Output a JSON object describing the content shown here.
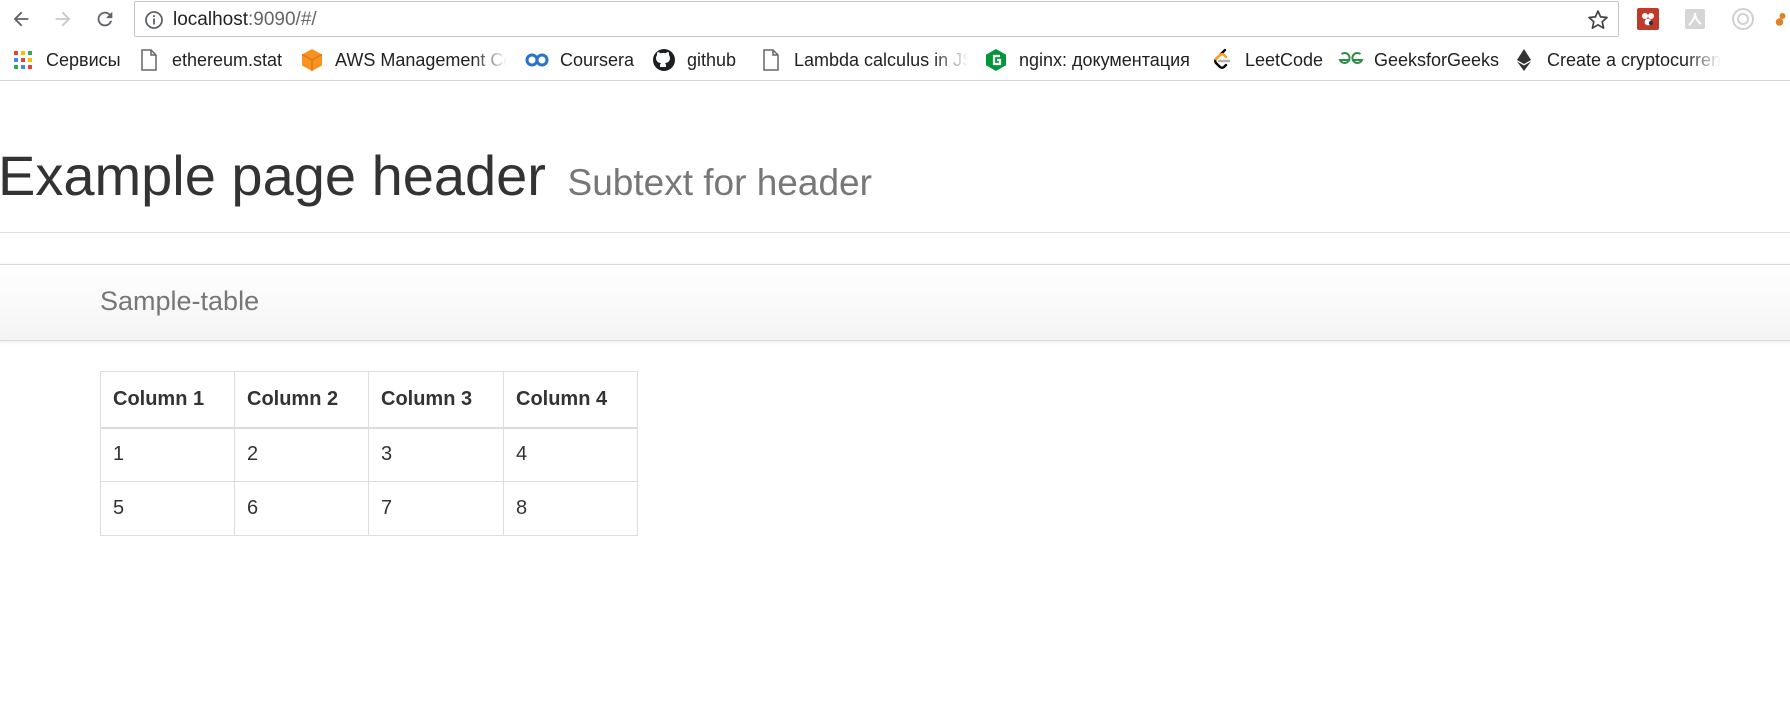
{
  "browser": {
    "url_host": "localhost",
    "url_rest": ":9090/#/"
  },
  "bookmarks": [
    {
      "label": "Сервисы",
      "icon": "apps-grid-icon"
    },
    {
      "label": "ethereum.stat",
      "icon": "page-icon"
    },
    {
      "label": "AWS Management Co",
      "icon": "aws-cube-icon"
    },
    {
      "label": "Coursera",
      "icon": "coursera-icon"
    },
    {
      "label": "github",
      "icon": "github-icon"
    },
    {
      "label": "Lambda calculus in JS",
      "icon": "page-icon"
    },
    {
      "label": "nginx: документация",
      "icon": "nginx-icon"
    },
    {
      "label": "LeetCode",
      "icon": "leetcode-icon"
    },
    {
      "label": "GeeksforGeeks",
      "icon": "geeksforgeeks-icon"
    },
    {
      "label": "Create a cryptocurren",
      "icon": "ethereum-icon"
    }
  ],
  "header": {
    "title": "Example page header",
    "subtitle": "Subtext for header"
  },
  "navbar": {
    "brand": "Sample-table"
  },
  "table": {
    "columns": [
      "Column 1",
      "Column 2",
      "Column 3",
      "Column 4"
    ],
    "rows": [
      [
        "1",
        "2",
        "3",
        "4"
      ],
      [
        "5",
        "6",
        "7",
        "8"
      ]
    ]
  },
  "colors": {
    "accent_orange": "#f7931e",
    "nginx_green": "#009639",
    "text_muted": "#777777"
  }
}
